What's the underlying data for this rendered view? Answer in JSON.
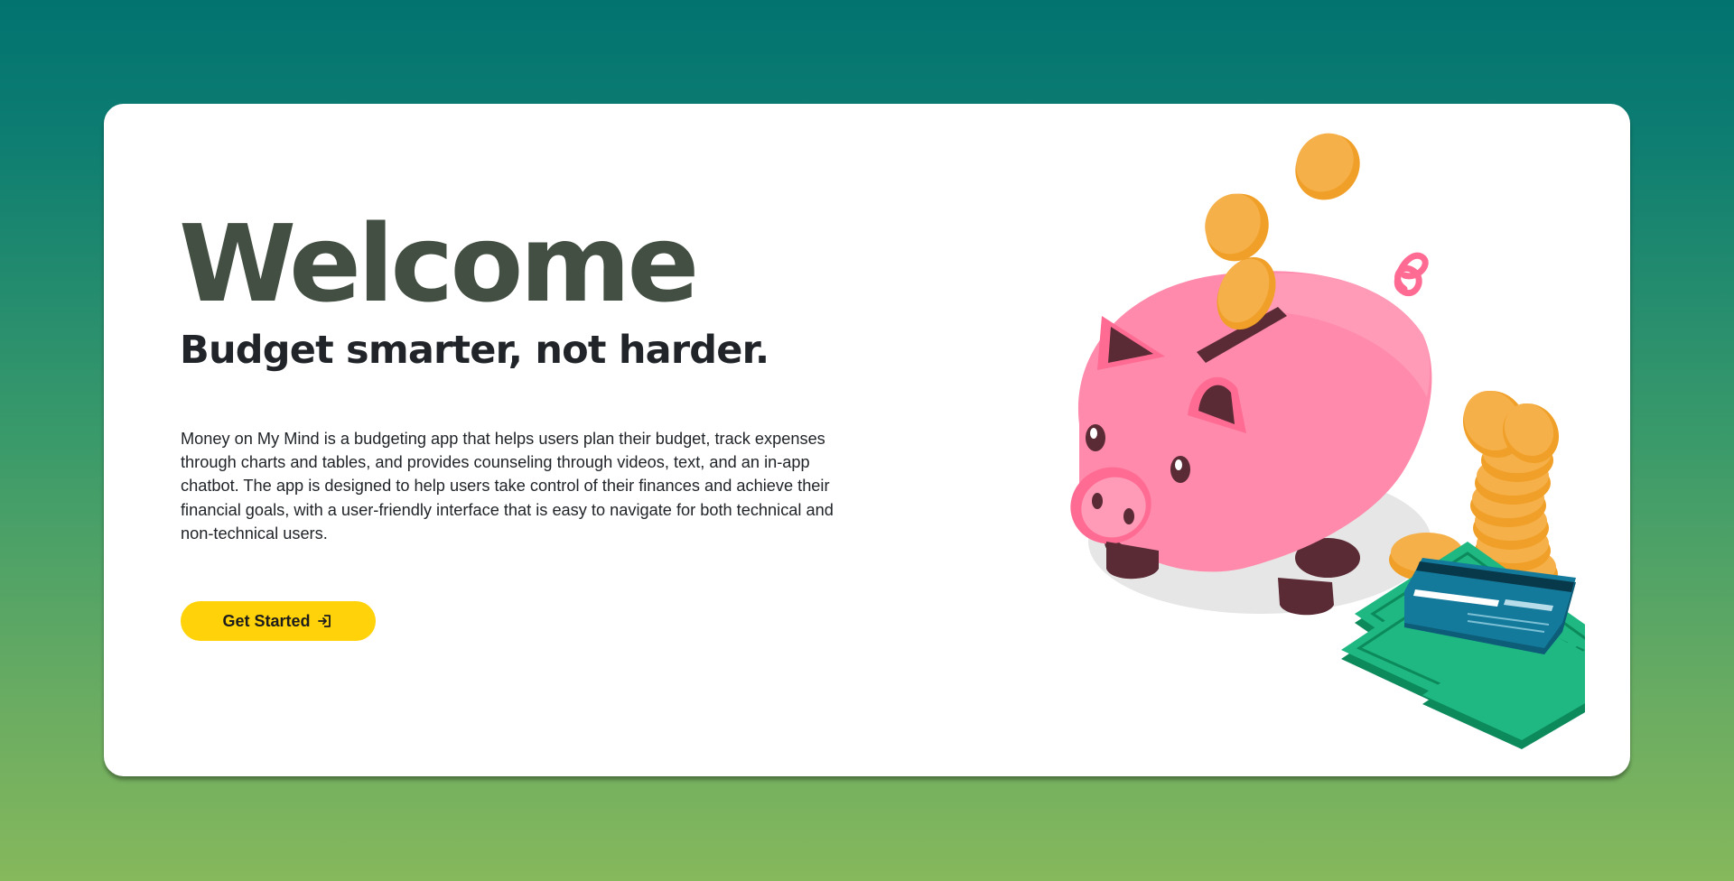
{
  "hero": {
    "title": "Welcome",
    "tagline": "Budget smarter, not harder.",
    "description": "Money on My Mind is a budgeting app that helps users plan their budget, track expenses through charts and tables, and provides counseling through videos, text, and an in-app chatbot. The app is designed to help users take control of their finances and achieve their financial goals, with a user-friendly interface that is easy to navigate for both technical and non-technical users.",
    "cta_label": "Get Started",
    "cta_icon": "sign-in-icon"
  },
  "colors": {
    "background_top": "#02736f",
    "background_bottom": "#86b85c",
    "title": "#434f43",
    "cta": "#ffd20a",
    "pig": "#ff8aab",
    "coin": "#f5b342",
    "cash": "#1fb782",
    "card": "#0f6f8f"
  },
  "illustration": {
    "name": "piggy-bank-illustration"
  }
}
